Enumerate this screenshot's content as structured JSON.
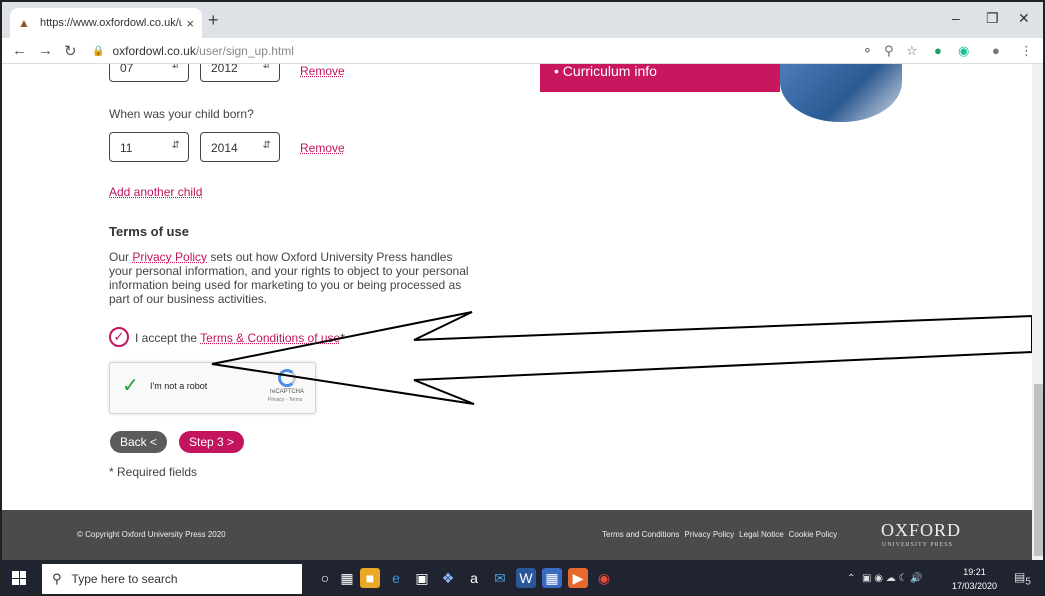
{
  "browser": {
    "tab_title": "https://www.oxfordowl.co.uk/use",
    "tab_close": "×",
    "new_tab": "+",
    "url_domain": "oxfordowl.co.uk",
    "url_path": "/user/sign_up.html"
  },
  "form": {
    "row1": {
      "month": "07",
      "year": "2012",
      "remove": "Remove"
    },
    "born_label": "When was your child born?",
    "row2": {
      "month": "11",
      "year": "2014",
      "remove": "Remove"
    },
    "add_child": "Add another child",
    "terms_heading": "Terms of use",
    "privacy_pre": "Our ",
    "privacy_link": "Privacy Policy",
    "privacy_post": " sets out how Oxford University Press handles your personal information, and your rights to object to your personal information being used for marketing to you or being processed as part of our business activities.",
    "accept_pre": "I accept the ",
    "accept_link": "Terms & Conditions of use",
    "accept_star": "*",
    "captcha_text": "I'm not a robot",
    "captcha_brand": "reCAPTCHA",
    "captcha_terms": "Privacy - Terms",
    "back_label": "Back  <",
    "next_label": "Step 3  >",
    "required_note": "* Required fields"
  },
  "promo": {
    "text": "• Curriculum info"
  },
  "footer": {
    "copyright": "© Copyright Oxford University Press 2020",
    "links": [
      "Terms and Conditions",
      "Privacy Policy",
      "Legal Notice",
      "Cookie Policy"
    ],
    "logo_main": "OXFORD",
    "logo_sub": "UNIVERSITY PRESS"
  },
  "taskbar": {
    "search_placeholder": "Type here to search",
    "time": "19:21",
    "date": "17/03/2020",
    "notif_count": "5"
  },
  "colors": {
    "accent": "#c4145e",
    "footer_bg": "#4b4b4b",
    "taskbar_bg": "#1f2430"
  }
}
